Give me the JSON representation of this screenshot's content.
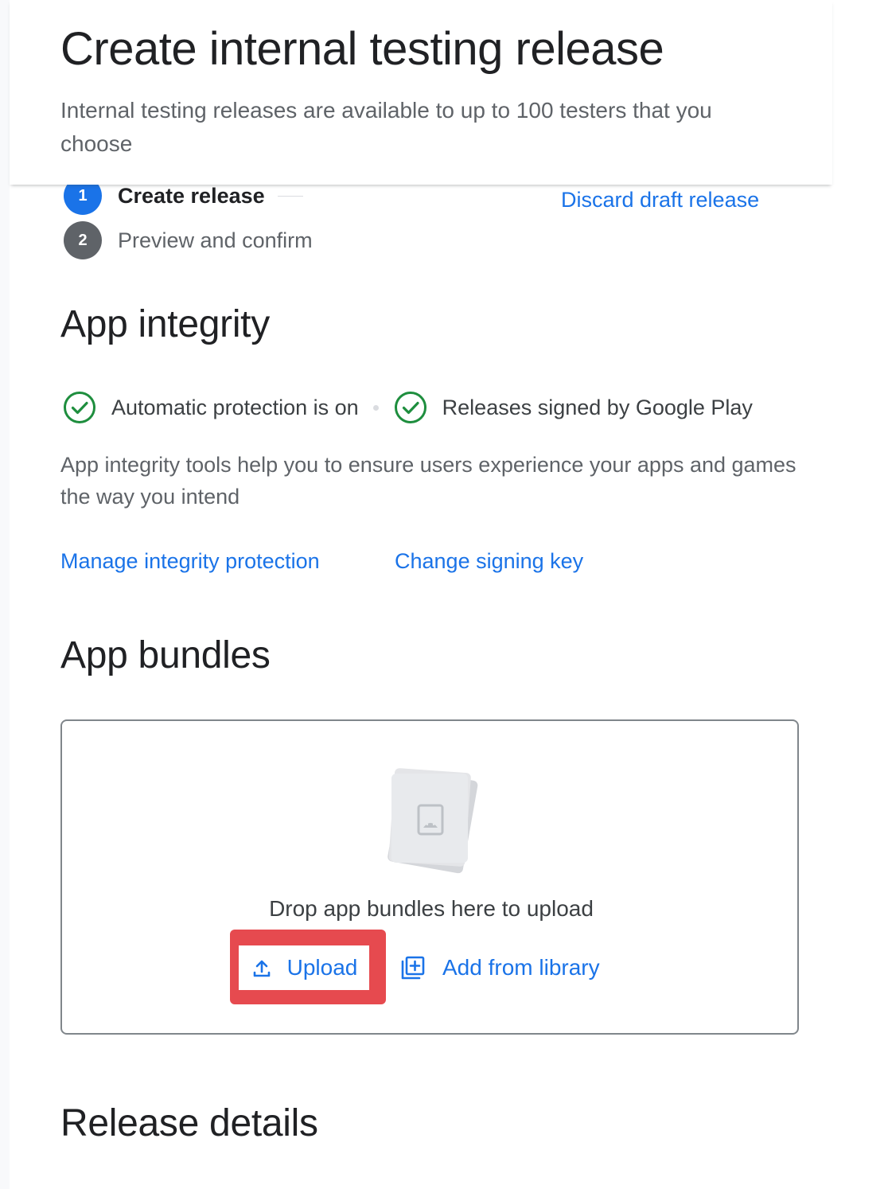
{
  "header": {
    "title": "Create internal testing release",
    "subtitle": "Internal testing releases are available to up to 100 testers that you choose"
  },
  "stepper": {
    "steps": [
      {
        "number": "1",
        "label": "Create release",
        "state": "active"
      },
      {
        "number": "2",
        "label": "Preview and confirm",
        "state": "inactive"
      }
    ]
  },
  "discard_link": "Discard draft release",
  "app_integrity": {
    "title": "App integrity",
    "statuses": [
      {
        "icon": "check-circle-icon",
        "label": "Automatic protection is on"
      },
      {
        "icon": "check-circle-icon",
        "label": "Releases signed by Google Play"
      }
    ],
    "description": "App integrity tools help you to ensure users experience your apps and games the way you intend",
    "links": {
      "manage": "Manage integrity protection",
      "signing": "Change signing key"
    }
  },
  "app_bundles": {
    "title": "App bundles",
    "drop_text": "Drop app bundles here to upload",
    "upload_label": "Upload",
    "upload_icon": "upload-icon",
    "library_label": "Add from library",
    "library_icon": "add-to-library-icon",
    "illustration_icon": "android-file-icon"
  },
  "release_details": {
    "title": "Release details"
  },
  "colors": {
    "accent": "#1a73e8",
    "success": "#1e8e3e",
    "highlight": "#e64a4f",
    "step_inactive": "#5f6368"
  }
}
